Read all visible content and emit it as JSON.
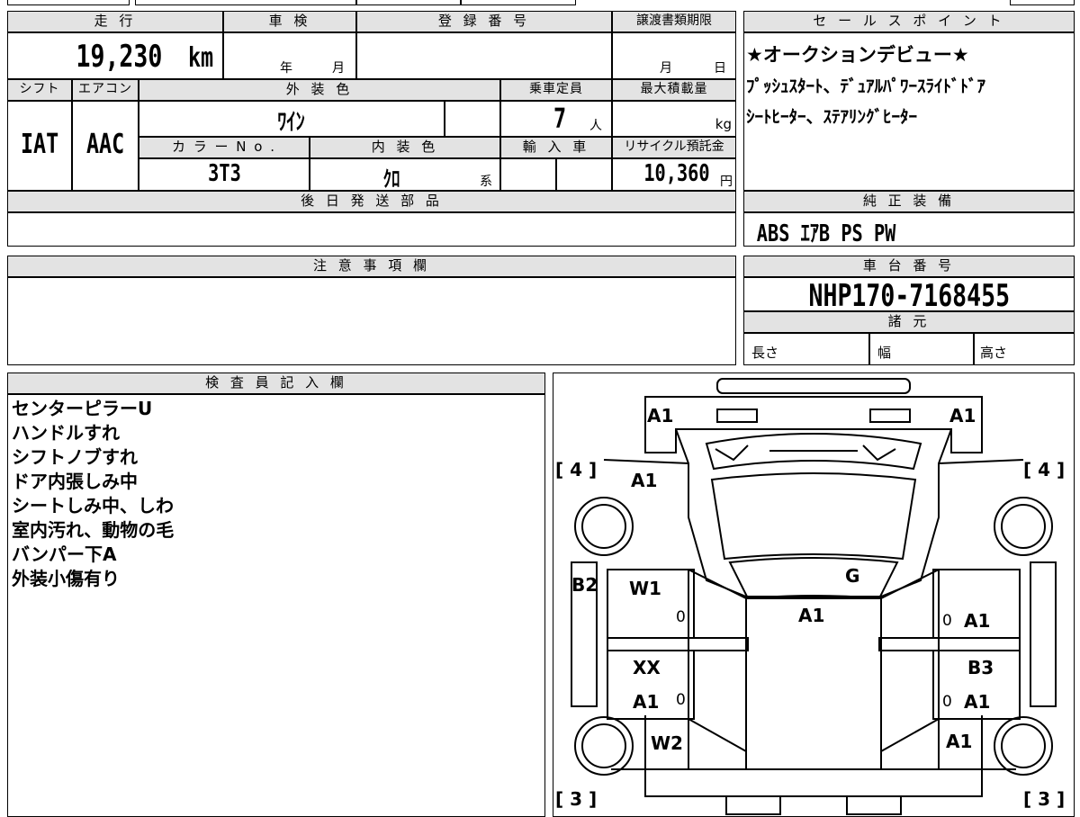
{
  "top_row": {
    "mileage_label": "走 行",
    "inspection_label": "車 検",
    "reg_label": "登 録 番 号",
    "transfer_label": "譲渡書類期限",
    "mileage_value": "19,230",
    "mileage_unit": "km",
    "year_label": "年",
    "month_label": "月",
    "transfer_month": "月",
    "transfer_day": "日"
  },
  "specs": {
    "shift_label": "シフト",
    "ac_label": "エアコン",
    "ext_color_label": "外 装 色",
    "capacity_label": "乗車定員",
    "max_load_label": "最大積載量",
    "shift_value": "IAT",
    "ac_value": "AAC",
    "ext_color_value": "ﾜｲﾝ",
    "capacity_value": "7",
    "capacity_unit": "人",
    "load_unit": "kg",
    "color_no_label": "カ ラ ー N o .",
    "int_color_label": "内 装 色",
    "import_label": "輸 入 車",
    "recycle_label": "リサイクル預託金",
    "color_no_value": "3T3",
    "int_color_value": "ｸﾛ",
    "int_color_suffix": "系",
    "recycle_value": "10,360",
    "recycle_unit": "円"
  },
  "later_parts": {
    "label": "後 日 発 送 部 品"
  },
  "caution": {
    "label": "注 意 事 項 欄"
  },
  "sales_point": {
    "label": "セ ー ル ス ポ イ ン ト",
    "lines": [
      "★オークションデビュー★",
      "ﾌﾟｯｼｭｽﾀｰﾄ、ﾃﾞｭｱﾙﾊﾟﾜｰｽﾗｲﾄﾞﾄﾞｱ",
      "ｼｰﾄﾋｰﾀｰ、ｽﾃｱﾘﾝｸﾞﾋｰﾀｰ"
    ]
  },
  "equipment": {
    "label": "純 正 装 備",
    "value": "ABS ｴｱB PS PW"
  },
  "chassis": {
    "label": "車 台 番 号",
    "value": "NHP170-7168455"
  },
  "dimensions": {
    "label": "諸 元",
    "length": "長さ",
    "width": "幅",
    "height": "高さ"
  },
  "inspector": {
    "label": "検 査 員 記 入 欄",
    "notes": [
      "センターピラーU",
      "ハンドルすれ",
      "シフトノブすれ",
      "ドア内張しみ中",
      "シートしみ中、しわ",
      "室内汚れ、動物の毛",
      "バンパー下A",
      "外装小傷有り"
    ]
  },
  "diagram": {
    "marks": {
      "front_left": "A1",
      "front_right": "A1",
      "hood_left": "A1",
      "windshield": "G",
      "roof": "A1",
      "left_front_fender": "B2",
      "left_front_door": "W1",
      "left_rear_door_top": "XX",
      "left_rear_door": "A1",
      "left_rear_quarter": "W2",
      "right_front_door": "A1",
      "right_rear_door_top": "B3",
      "right_rear_door": "A1",
      "right_rear_quarter": "A1",
      "zero": "0"
    },
    "brackets": {
      "front_left": "[ 4 ]",
      "front_right": "[ 4 ]",
      "rear_left": "[ 3 ]",
      "rear_right": "[ 3 ]"
    }
  }
}
